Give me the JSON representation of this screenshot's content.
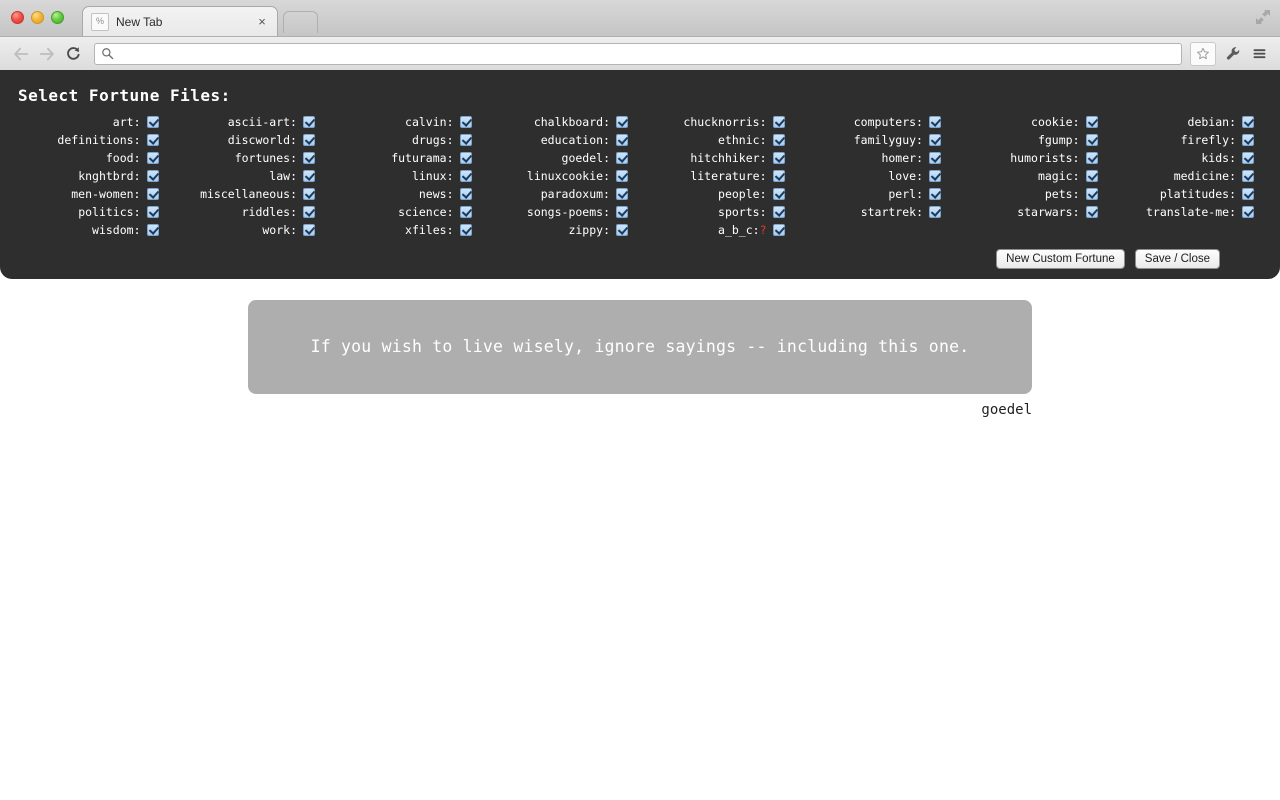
{
  "browser": {
    "window_controls": [
      "close",
      "minimize",
      "maximize"
    ],
    "fullscreen_icon": "fullscreen-arrows-icon",
    "tab": {
      "title": "New Tab",
      "favicon_glyph": "%",
      "close_glyph": "×"
    },
    "new_tab_button_label": "",
    "toolbar": {
      "back_icon": "back-arrow-icon",
      "forward_icon": "forward-arrow-icon",
      "reload_icon": "reload-icon",
      "search_icon": "search-icon",
      "address_value": "",
      "address_placeholder": "",
      "bookmark_icon": "star-icon",
      "wrench_icon": "wrench-icon",
      "menu_icon": "hamburger-menu-icon"
    }
  },
  "panel": {
    "title": "Select Fortune Files:",
    "buttons": {
      "new_custom_fortune": "New Custom Fortune",
      "save_close": "Save / Close"
    },
    "columns": [
      [
        {
          "label": "art:",
          "checked": true
        },
        {
          "label": "definitions:",
          "checked": true
        },
        {
          "label": "food:",
          "checked": true
        },
        {
          "label": "knghtbrd:",
          "checked": true
        },
        {
          "label": "men-women:",
          "checked": true
        },
        {
          "label": "politics:",
          "checked": true
        },
        {
          "label": "wisdom:",
          "checked": true
        }
      ],
      [
        {
          "label": "ascii-art:",
          "checked": true
        },
        {
          "label": "discworld:",
          "checked": true
        },
        {
          "label": "fortunes:",
          "checked": true
        },
        {
          "label": "law:",
          "checked": true
        },
        {
          "label": "miscellaneous:",
          "checked": true
        },
        {
          "label": "riddles:",
          "checked": true
        },
        {
          "label": "work:",
          "checked": true
        }
      ],
      [
        {
          "label": "calvin:",
          "checked": true
        },
        {
          "label": "drugs:",
          "checked": true
        },
        {
          "label": "futurama:",
          "checked": true
        },
        {
          "label": "linux:",
          "checked": true
        },
        {
          "label": "news:",
          "checked": true
        },
        {
          "label": "science:",
          "checked": true
        },
        {
          "label": "xfiles:",
          "checked": true
        }
      ],
      [
        {
          "label": "chalkboard:",
          "checked": true
        },
        {
          "label": "education:",
          "checked": true
        },
        {
          "label": "goedel:",
          "checked": true
        },
        {
          "label": "linuxcookie:",
          "checked": true
        },
        {
          "label": "paradoxum:",
          "checked": true
        },
        {
          "label": "songs-poems:",
          "checked": true
        },
        {
          "label": "zippy:",
          "checked": true
        }
      ],
      [
        {
          "label": "chucknorris:",
          "checked": true
        },
        {
          "label": "ethnic:",
          "checked": true
        },
        {
          "label": "hitchhiker:",
          "checked": true
        },
        {
          "label": "literature:",
          "checked": true
        },
        {
          "label": "people:",
          "checked": true
        },
        {
          "label": "sports:",
          "checked": true
        },
        {
          "label": "a_b_c:",
          "checked": true,
          "warn": "?"
        }
      ],
      [
        {
          "label": "computers:",
          "checked": true
        },
        {
          "label": "familyguy:",
          "checked": true
        },
        {
          "label": "homer:",
          "checked": true
        },
        {
          "label": "love:",
          "checked": true
        },
        {
          "label": "perl:",
          "checked": true
        },
        {
          "label": "startrek:",
          "checked": true
        }
      ],
      [
        {
          "label": "cookie:",
          "checked": true
        },
        {
          "label": "fgump:",
          "checked": true
        },
        {
          "label": "humorists:",
          "checked": true
        },
        {
          "label": "magic:",
          "checked": true
        },
        {
          "label": "pets:",
          "checked": true
        },
        {
          "label": "starwars:",
          "checked": true
        }
      ],
      [
        {
          "label": "debian:",
          "checked": true
        },
        {
          "label": "firefly:",
          "checked": true
        },
        {
          "label": "kids:",
          "checked": true
        },
        {
          "label": "medicine:",
          "checked": true
        },
        {
          "label": "platitudes:",
          "checked": true
        },
        {
          "label": "translate-me:",
          "checked": true
        }
      ]
    ]
  },
  "fortune": {
    "text": "If you wish to live wisely, ignore sayings -- including this one.",
    "source": "goedel"
  },
  "colors": {
    "panel_bg": "#2e2e2e",
    "quote_bg": "#aeaeae",
    "checkbox": "#a9ccee",
    "warn": "#e03a30"
  }
}
